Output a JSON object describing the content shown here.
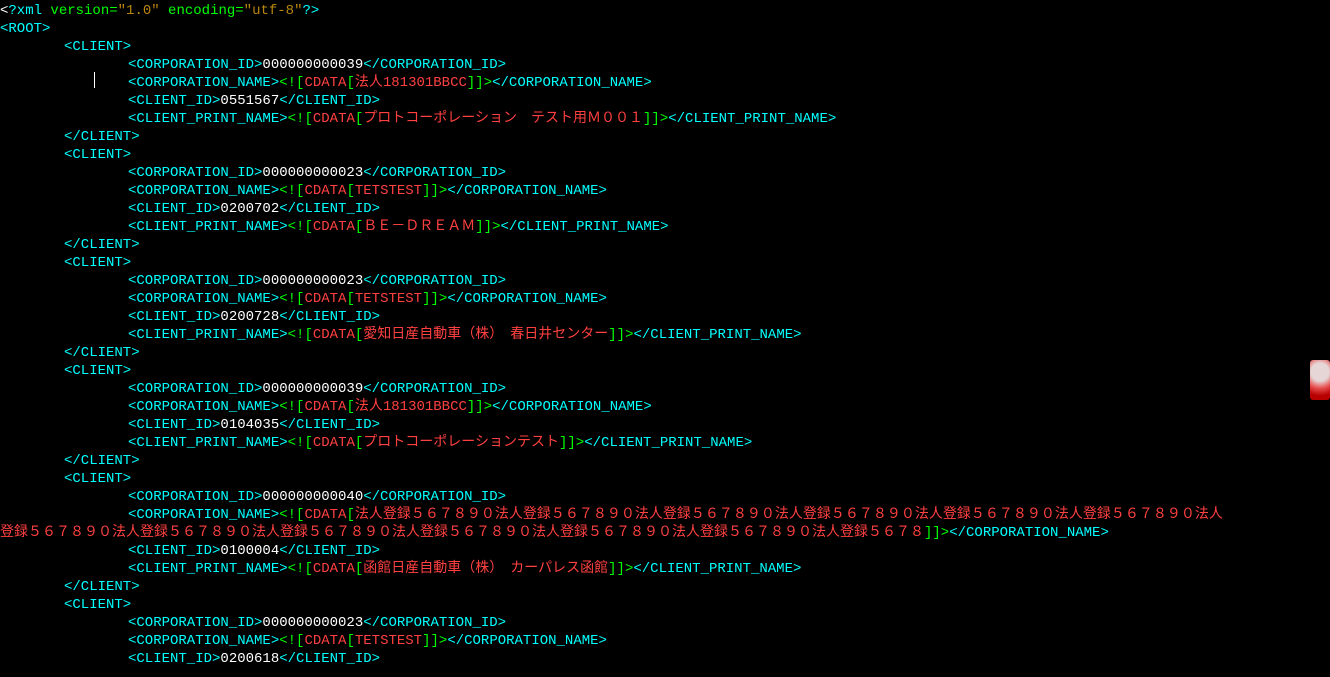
{
  "xml_decl": {
    "open": "?xml",
    "version_attr": " version=",
    "version_val": "\"1.0\"",
    "encoding_attr": " encoding=",
    "encoding_val": "\"utf-8\"",
    "close": "?>"
  },
  "tags": {
    "root_open": "<ROOT>",
    "client_open": "<CLIENT>",
    "client_close": "</CLIENT>",
    "corp_id_open": "<CORPORATION_ID>",
    "corp_id_close": "</CORPORATION_ID>",
    "corp_name_open": "<CORPORATION_NAME>",
    "corp_name_close": "</CORPORATION_NAME>",
    "client_id_open": "<CLIENT_ID>",
    "client_id_close": "</CLIENT_ID>",
    "client_print_open": "<CLIENT_PRINT_NAME>",
    "client_print_close": "</CLIENT_PRINT_NAME>",
    "cdata_open_bang": "<![",
    "cdata_word": "CDATA",
    "cdata_lbracket": "[",
    "cdata_close": "]]>"
  },
  "clients": [
    {
      "corp_id": "000000000039",
      "corp_name": "法人181301BBCC",
      "client_id": "0551567",
      "print_name": "プロトコーポレーション　テスト用Ｍ００１"
    },
    {
      "corp_id": "000000000023",
      "corp_name": "TETSTEST",
      "client_id": "0200702",
      "print_name": "ＢＥ－ＤＲＥＡＭ"
    },
    {
      "corp_id": "000000000023",
      "corp_name": "TETSTEST",
      "client_id": "0200728",
      "print_name": "愛知日産自動車（株）　春日井センター"
    },
    {
      "corp_id": "000000000039",
      "corp_name": "法人181301BBCC",
      "client_id": "0104035",
      "print_name": "プロトコーポレーションテスト"
    },
    {
      "corp_id": "000000000040",
      "corp_name_line1": "法人登録５６７８９０法人登録５６７８９０法人登録５６７８９０法人登録５６７８９０法人登録５６７８９０法人登録５６７８９０法人",
      "corp_name_line2": "登録５６７８９０法人登録５６７８９０法人登録５６７８９０法人登録５６７８９０法人登録５６７８９０法人登録５６７８９０法人登録５６７８",
      "client_id": "0100004",
      "print_name": "函館日産自動車（株）　カーパレス函館"
    },
    {
      "corp_id": "000000000023",
      "corp_name": "TETSTEST",
      "client_id": "0200618"
    }
  ]
}
